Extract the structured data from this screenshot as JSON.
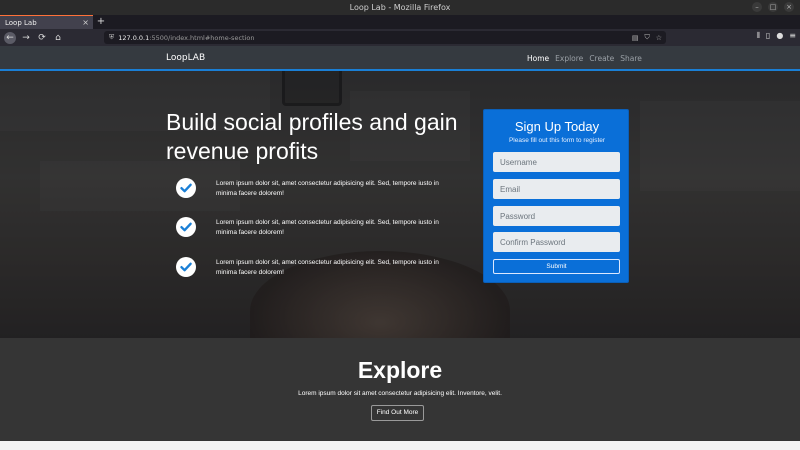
{
  "window": {
    "title": "Loop Lab - Mozilla Firefox",
    "minimize_label": "–",
    "maximize_label": "□",
    "close_label": "×"
  },
  "browser": {
    "tab": {
      "title": "Loop Lab",
      "close": "×"
    },
    "new_tab_label": "+",
    "url": {
      "host": "127.0.0.1",
      "path": ":5500/index.html#home-section"
    },
    "icons": {
      "back": "←",
      "forward": "→",
      "reload": "⟳",
      "home": "⌂",
      "reader": "▤",
      "pocket": "⛉",
      "bookmark": "☆",
      "library": "⫴",
      "sidebar": "▯",
      "account": "●",
      "menu": "≡"
    }
  },
  "site": {
    "brand": "LoopLAB",
    "nav": [
      {
        "label": "Home",
        "active": true
      },
      {
        "label": "Explore",
        "active": false
      },
      {
        "label": "Create",
        "active": false
      },
      {
        "label": "Share",
        "active": false
      }
    ]
  },
  "hero": {
    "title": "Build social profiles and gain revenue profits",
    "features": [
      "Lorem ipsum dolor sit, amet consectetur adipisicing elit. Sed, tempore iusto in minima facere dolorem!",
      "Lorem ipsum dolor sit, amet consectetur adipisicing elit. Sed, tempore iusto in minima facere dolorem!",
      "Lorem ipsum dolor sit, amet consectetur adipisicing elit. Sed, tempore iusto in minima facere dolorem!"
    ]
  },
  "signup": {
    "title": "Sign Up Today",
    "subtitle": "Please fill out this form to register",
    "username_placeholder": "Username",
    "email_placeholder": "Email",
    "password_placeholder": "Password",
    "confirm_placeholder": "Confirm Password",
    "submit_label": "Submit"
  },
  "explore": {
    "title": "Explore",
    "text": "Lorem ipsum dolor sit amet consectetur adipisicing elit. Inventore, velit.",
    "button_label": "Find Out More"
  },
  "colors": {
    "accent": "#0a6fd8",
    "header": "#353a40",
    "explore_bg": "#353535"
  }
}
